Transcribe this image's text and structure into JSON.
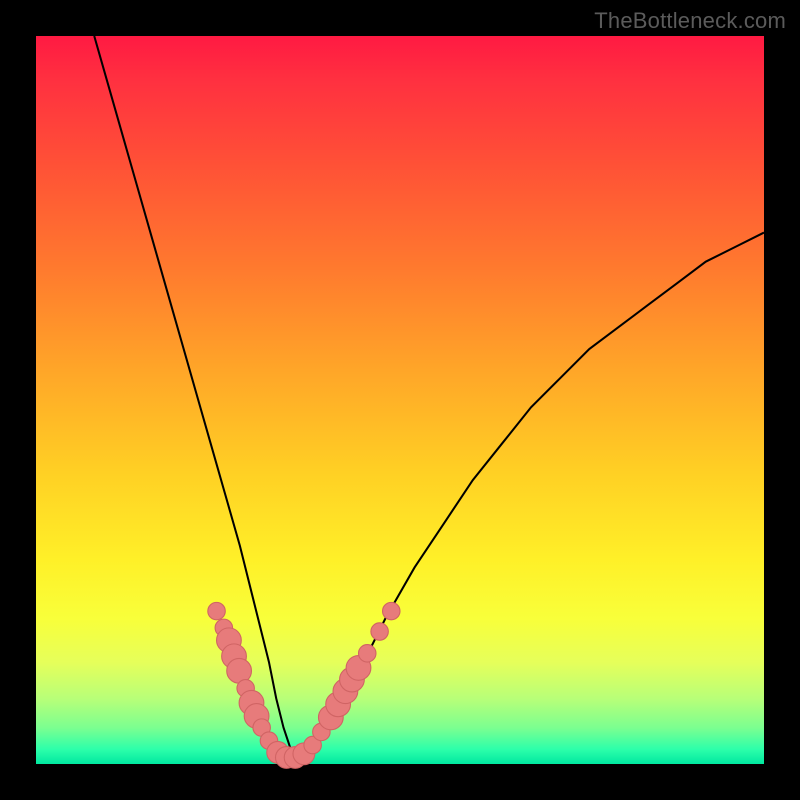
{
  "watermark": "TheBottleneck.com",
  "colors": {
    "frame": "#000000",
    "curve": "#000000",
    "marker_fill": "#e77b7b",
    "marker_stroke": "#d06464"
  },
  "chart_data": {
    "type": "line",
    "title": "",
    "xlabel": "",
    "ylabel": "",
    "xlim": [
      0,
      100
    ],
    "ylim": [
      0,
      100
    ],
    "background_gradient": {
      "top_color": "#ff1a42",
      "bottom_color": "#00e8a0",
      "description": "vertical red→orange→yellow→green gradient"
    },
    "series": [
      {
        "name": "bottleneck-curve",
        "x": [
          8,
          10,
          12,
          14,
          16,
          18,
          20,
          22,
          24,
          26,
          28,
          30,
          32,
          33,
          34,
          35,
          36,
          38,
          40,
          44,
          48,
          52,
          56,
          60,
          64,
          68,
          72,
          76,
          80,
          84,
          88,
          92,
          96,
          100
        ],
        "y": [
          100,
          93,
          86,
          79,
          72,
          65,
          58,
          51,
          44,
          37,
          30,
          22,
          14,
          9,
          5,
          2,
          1,
          2,
          5,
          12,
          20,
          27,
          33,
          39,
          44,
          49,
          53,
          57,
          60,
          63,
          66,
          69,
          71,
          73
        ]
      }
    ],
    "markers": [
      {
        "x": 24.8,
        "y": 21.0,
        "r": 1.2
      },
      {
        "x": 25.8,
        "y": 18.7,
        "r": 1.2
      },
      {
        "x": 26.5,
        "y": 17.0,
        "r": 1.7
      },
      {
        "x": 27.2,
        "y": 14.8,
        "r": 1.7
      },
      {
        "x": 27.9,
        "y": 12.8,
        "r": 1.7
      },
      {
        "x": 28.8,
        "y": 10.4,
        "r": 1.2
      },
      {
        "x": 29.6,
        "y": 8.4,
        "r": 1.7
      },
      {
        "x": 30.3,
        "y": 6.6,
        "r": 1.7
      },
      {
        "x": 31.0,
        "y": 5.0,
        "r": 1.2
      },
      {
        "x": 32.0,
        "y": 3.2,
        "r": 1.2
      },
      {
        "x": 33.2,
        "y": 1.6,
        "r": 1.5
      },
      {
        "x": 34.4,
        "y": 0.9,
        "r": 1.5
      },
      {
        "x": 35.6,
        "y": 0.9,
        "r": 1.5
      },
      {
        "x": 36.8,
        "y": 1.4,
        "r": 1.5
      },
      {
        "x": 38.0,
        "y": 2.6,
        "r": 1.2
      },
      {
        "x": 39.2,
        "y": 4.4,
        "r": 1.2
      },
      {
        "x": 40.5,
        "y": 6.4,
        "r": 1.7
      },
      {
        "x": 41.5,
        "y": 8.2,
        "r": 1.7
      },
      {
        "x": 42.5,
        "y": 10.0,
        "r": 1.7
      },
      {
        "x": 43.4,
        "y": 11.6,
        "r": 1.7
      },
      {
        "x": 44.3,
        "y": 13.2,
        "r": 1.7
      },
      {
        "x": 45.5,
        "y": 15.2,
        "r": 1.2
      },
      {
        "x": 47.2,
        "y": 18.2,
        "r": 1.2
      },
      {
        "x": 48.8,
        "y": 21.0,
        "r": 1.2
      }
    ]
  }
}
